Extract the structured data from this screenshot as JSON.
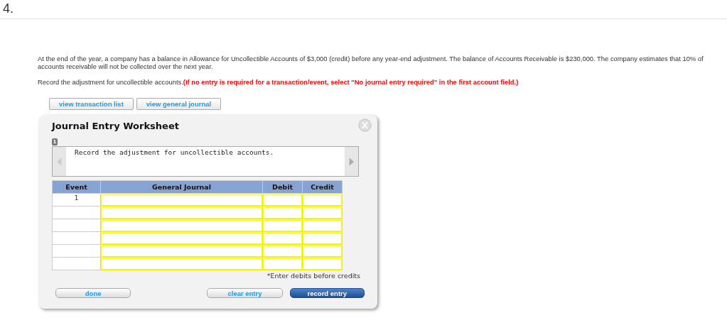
{
  "question_number": "4.",
  "problem": {
    "text": "At the end of the year, a company has a balance in Allowance for Uncollectible Accounts of $3,000 (credit) before any year-end adjustment. The balance of Accounts Receivable is $230,000. The company estimates that 10% of accounts receivable will not be collected over the next year.",
    "instruction": "Record the adjustment for uncollectible accounts.",
    "note": "(If no entry is required for a transaction/event, select \"No journal entry required\" in the first account field.)"
  },
  "links": [
    "view transaction list",
    "view general journal"
  ],
  "worksheet": {
    "title": "Journal Entry Worksheet",
    "step": "1",
    "prompt": "Record the adjustment for uncollectible accounts.",
    "table": {
      "columns": [
        "Event",
        "General Journal",
        "Debit",
        "Credit"
      ],
      "rows": [
        {
          "event": "1"
        },
        {},
        {},
        {},
        {},
        {}
      ]
    },
    "footnote": "*Enter debits before credits",
    "buttons": [
      {
        "label": "done",
        "kind": "plain"
      },
      {
        "label": "clear entry",
        "kind": "plain"
      },
      {
        "label": "record entry",
        "kind": "primary"
      }
    ]
  }
}
